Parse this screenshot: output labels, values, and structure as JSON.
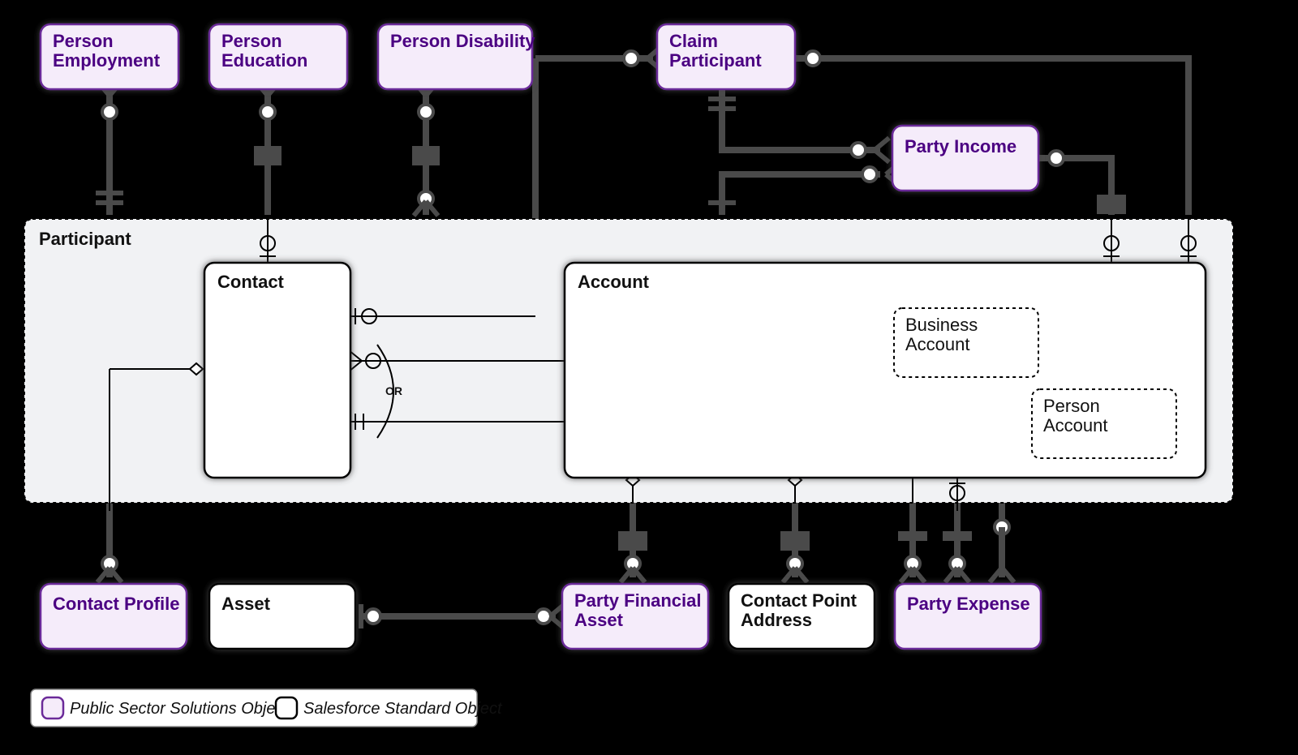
{
  "diagram": {
    "participant_label": "Participant",
    "or_label": "OR"
  },
  "entities": {
    "person_employment": "Person Employment",
    "person_education": "Person Education",
    "person_disability": "Person Disability",
    "claim_participant": "Claim Participant",
    "party_income": "Party Income",
    "contact": "Contact",
    "account": "Account",
    "business_account_l1": "Business",
    "business_account_l2": "Account",
    "person_account_l1": "Person",
    "person_account_l2": "Account",
    "contact_profile": "Contact Profile",
    "asset": "Asset",
    "party_financial_asset_l1": "Party Financial",
    "party_financial_asset_l2": "Asset",
    "contact_point_address_l1": "Contact Point",
    "contact_point_address_l2": "Address",
    "party_expense": "Party Expense"
  },
  "legend": {
    "public_sector": "Public Sector Solutions Object",
    "standard": "Salesforce Standard Object"
  }
}
